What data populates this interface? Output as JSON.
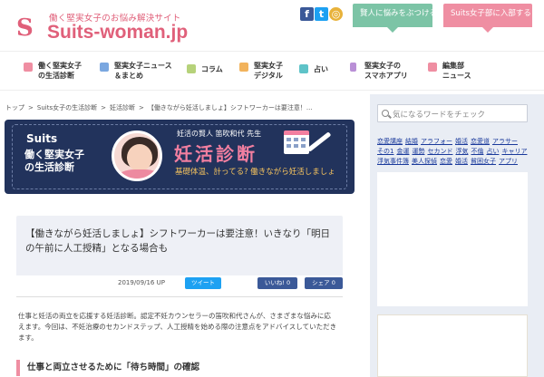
{
  "header": {
    "tagline": "働く堅実女子のお悩み解決サイト",
    "logo_mark": "S",
    "logo_text": "Suits-woman.jp",
    "sns": [
      "f",
      "t",
      "◎"
    ],
    "btn_consult": "賢人に悩みをぶつける",
    "btn_join": "Suits女子部に入部する",
    "colors": {
      "brand": "#e0607a",
      "green": "#7cc4a6",
      "pink": "#ef8ea2"
    }
  },
  "nav": [
    {
      "label": "働く堅実女子\nの生活診断",
      "icon": "heart-icon",
      "color": "#ef8ea2"
    },
    {
      "label": "堅実女子ニュース\n＆まとめ",
      "icon": "news-icon",
      "color": "#7aa7e0"
    },
    {
      "label": "コラム",
      "icon": "book-icon",
      "color": "#b6d27a"
    },
    {
      "label": "堅実女子\nデジタル",
      "icon": "bag-icon",
      "color": "#f2b35c"
    },
    {
      "label": "占い",
      "icon": "star-icon",
      "color": "#5ec3c8"
    },
    {
      "label": "堅実女子の\nスマホアプリ",
      "icon": "phone-icon",
      "color": "#b98fd6"
    },
    {
      "label": "編集部\nニュース",
      "icon": "grid-icon",
      "color": "#ef8ea2"
    }
  ],
  "breadcrumb": [
    "トップ",
    ">",
    "Suits女子の生活診断",
    ">",
    "妊活診断",
    ">",
    "【働きながら妊活しましょ】シフトワーカーは要注意！..."
  ],
  "banner": {
    "brand": "Suits",
    "brand_sub": "働く堅実女子\nの生活診断",
    "byline": "妊活の賢人 笛吹和代 先生",
    "title": "妊活診断",
    "catch": "基礎体温、計ってる? 働きながら妊活しましょ"
  },
  "article": {
    "title": "【働きながら妊活しましょ】シフトワーカーは要注意！いきなり「明日の午前に人工授精」となる場合も",
    "date": "2019/09/16 UP",
    "btn_tweet": "ツイート",
    "btn_like": "いいね! 0",
    "btn_share": "シェア 0",
    "lead": "仕事と妊活の両立を応援する妊活診断。認定不妊カウンセラーの笛吹和代さんが、さまざまな悩みに応えます。今回は、不妊治療のセカンドステップ、人工授精を始める際の注意点をアドバイスしていただきます。",
    "section": "仕事と両立させるために「待ち時間」の確認"
  },
  "sidebar": {
    "search_placeholder": "気になるワードをチェック",
    "tags": [
      "恋愛講座",
      "結婚",
      "アラフォー",
      "婚活",
      "恋愛道",
      "アラサー",
      "その1",
      "金運",
      "運勢",
      "セカンド",
      "浮気",
      "不倫",
      "占い",
      "キャリア",
      "浮気事件簿",
      "美人探偵",
      "恋愛",
      "婚活",
      "貧困女子",
      "アプリ"
    ]
  }
}
